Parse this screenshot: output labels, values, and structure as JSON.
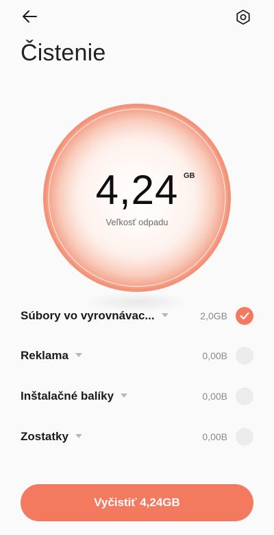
{
  "header": {
    "back_icon": "arrow-left-icon",
    "settings_icon": "settings-hexagon-icon",
    "title": "Čistenie"
  },
  "gauge": {
    "value": "4,24",
    "unit": "GB",
    "caption": "Veľkosť odpadu",
    "accent": "#f47a5f"
  },
  "items": [
    {
      "label": "Súbory vo vyrovnávac...",
      "size": "2,0GB",
      "checked": true
    },
    {
      "label": "Reklama",
      "size": "0,00B",
      "checked": false
    },
    {
      "label": "Inštalačné balíky",
      "size": "0,00B",
      "checked": false
    },
    {
      "label": "Zostatky",
      "size": "0,00B",
      "checked": false
    }
  ],
  "action": {
    "label": "Vyčistiť 4,24GB"
  }
}
